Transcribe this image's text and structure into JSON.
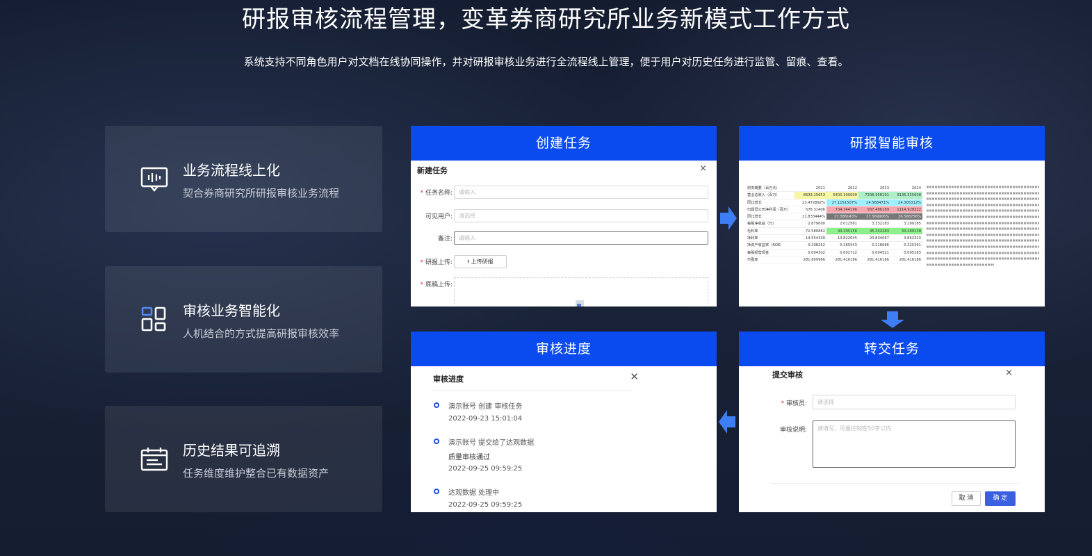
{
  "header": {
    "title": "研报审核流程管理，变革券商研究所业务新模式工作方式",
    "subtitle": "系统支持不同角色用户对文档在线协同操作，并对研报审核业务进行全流程线上管理，便于用户对历史任务进行监管、留痕、查看。"
  },
  "features": [
    {
      "title": "业务流程线上化",
      "desc": "契合券商研究所研报审核业务流程",
      "icon": "message-board-icon"
    },
    {
      "title": "审核业务智能化",
      "desc": "人机结合的方式提高研报审核效率",
      "icon": "grid-blocks-icon"
    },
    {
      "title": "历史结果可追溯",
      "desc": "任务维度维护整合已有数据资产",
      "icon": "calendar-icon"
    }
  ],
  "panels": {
    "create": {
      "header": "创建任务",
      "dialog_title": "新建任务",
      "close": "×",
      "task_name_label": "任务名称:",
      "task_name_placeholder": "请输入",
      "visible_users_label": "可见用户:",
      "visible_users_placeholder": "请选择",
      "remark_label": "备注:",
      "remark_placeholder": "请输入",
      "report_upload_label": "研报上传:",
      "upload_button": "上传研报",
      "draft_upload_label": "底稿上传:"
    },
    "review": {
      "header": "研报智能审核",
      "table_header": [
        "",
        "2021",
        "2022",
        "2023",
        "2024"
      ],
      "table_rows": [
        [
          "财务概要（百万元）",
          "2021",
          "2022",
          "2023",
          "2024"
        ],
        [
          "营业总收入（百万）",
          "8633.15653",
          "5400.300000",
          "7336.958191",
          "9135.555608"
        ],
        [
          "同比增长",
          "23.472892%",
          "27.1151507%",
          "24.568471%",
          "24.305312%"
        ],
        [
          "归属母公司净利润（百万）",
          "576.31406",
          "734.344196",
          "937.496189",
          "1114.929222"
        ],
        [
          "同比增长",
          "21.833444%",
          "27.386143%",
          "27.569906%",
          "26.568756%"
        ],
        [
          "每股净收益（元）",
          "2.879000",
          "2.012561",
          "3.332183",
          "3.290185"
        ],
        [
          "毛利率",
          "72.580882",
          "43.295156",
          "45.342283",
          "33.289138"
        ],
        [
          "净利率",
          "14.554330",
          "13.822045",
          "20.834067",
          "3.862323"
        ],
        [
          "净资产收益率（ROE）",
          "0.208252",
          "0.265543",
          "0.218686",
          "0.325391"
        ],
        [
          "每股经营现金",
          "0.004302",
          "0.002722",
          "0.004521",
          "0.095183"
        ],
        [
          "市盈率",
          "281.809966",
          "281.416186",
          "281.416186",
          "281.416186"
        ]
      ]
    },
    "progress": {
      "header": "审核进度",
      "dialog_title": "审核进度",
      "close": "✕",
      "events": [
        {
          "text": "演示账号 创建 审核任务",
          "time": "2022-09-23 15:01:04"
        },
        {
          "text": "演示账号 提交给了达观数据",
          "sub": "质量审核通过",
          "time": "2022-09-25 09:59:25"
        },
        {
          "text": "达观数据 处理中",
          "time": "2022-09-25 09:59:25"
        }
      ]
    },
    "transfer": {
      "header": "转交任务",
      "dialog_title": "提交审核",
      "close": "×",
      "reviewer_label": "审核员:",
      "reviewer_placeholder": "请选择",
      "note_label": "审核说明:",
      "note_placeholder": "请填写，尽量控制在50字以内",
      "cancel_button": "取 消",
      "confirm_button": "确 定"
    }
  },
  "colors": {
    "panel_header": "#0a4bf0",
    "arrow": "#3d7ef5",
    "dot": "#1a4fd8"
  }
}
